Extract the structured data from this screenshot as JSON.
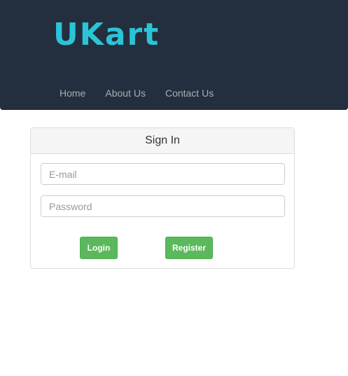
{
  "header": {
    "logo": "UKart",
    "nav": [
      {
        "label": "Home"
      },
      {
        "label": "About Us"
      },
      {
        "label": "Contact Us"
      }
    ]
  },
  "signin": {
    "title": "Sign In",
    "email_placeholder": "E-mail",
    "password_placeholder": "Password",
    "login_label": "Login",
    "register_label": "Register"
  },
  "colors": {
    "header_bg": "#232f3e",
    "logo": "#2bc4d6",
    "button": "#5cb85c"
  }
}
